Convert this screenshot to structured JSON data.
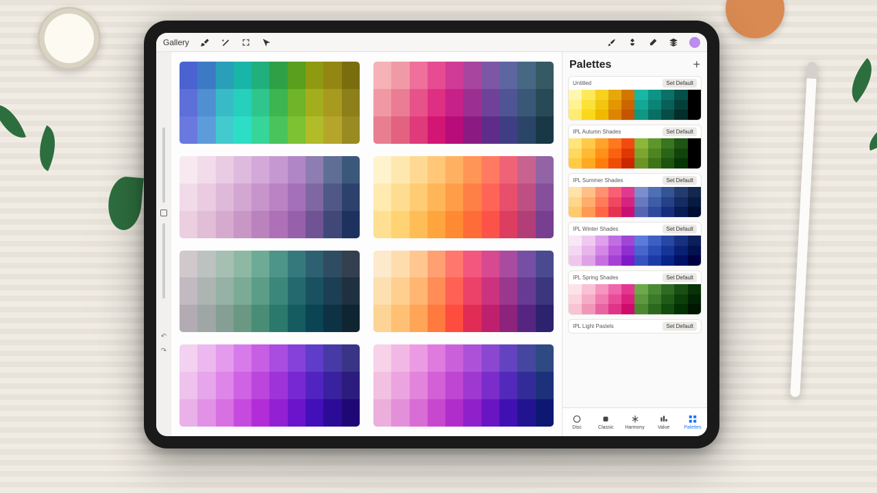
{
  "toolbar": {
    "gallery_label": "Gallery"
  },
  "panel": {
    "title": "Palettes",
    "set_default_label": "Set Default",
    "palettes": [
      {
        "name": "Untitled"
      },
      {
        "name": "IPL Autumn Shades"
      },
      {
        "name": "IPL Summer Shades"
      },
      {
        "name": "IPL Winter Shades"
      },
      {
        "name": "IPL Spring Shades"
      },
      {
        "name": "IPL Light Pastels"
      }
    ],
    "tabs": [
      {
        "label": "Disc"
      },
      {
        "label": "Classic"
      },
      {
        "label": "Harmony"
      },
      {
        "label": "Value"
      },
      {
        "label": "Palettes"
      }
    ],
    "active_tab": "Palettes"
  },
  "canvas_blocks": [
    {
      "name": "block-1",
      "rows": [
        [
          "#4a63d0",
          "#3d7ac6",
          "#2a9fb9",
          "#18b6a8",
          "#1fb07d",
          "#2fa046",
          "#5a9f1d",
          "#8f9a10",
          "#938612",
          "#7a6d0e"
        ],
        [
          "#5d6fd8",
          "#5090d2",
          "#38bbc6",
          "#26d0bc",
          "#2fc68e",
          "#3db551",
          "#6fb429",
          "#a3ae1c",
          "#a8991f",
          "#8d7f19"
        ],
        [
          "#6a79df",
          "#5d9cdb",
          "#43cacf",
          "#2ddec7",
          "#37d598",
          "#49c45c",
          "#7cc233",
          "#b1bc28",
          "#b5a62b",
          "#998a22"
        ]
      ]
    },
    {
      "name": "block-2",
      "rows": [
        [
          "#f6b2b7",
          "#f19aa7",
          "#ef709a",
          "#e74c93",
          "#d03b97",
          "#a8469f",
          "#7e56a6",
          "#5d66a1",
          "#476884",
          "#365a63"
        ],
        [
          "#f099a4",
          "#ea7d93",
          "#e8528a",
          "#de2f83",
          "#c52189",
          "#9b3092",
          "#704199",
          "#4f5494",
          "#395777",
          "#284956"
        ],
        [
          "#e97e91",
          "#e2627f",
          "#df3b7a",
          "#d31573",
          "#b70c7a",
          "#8b1b82",
          "#602c89",
          "#3f3e85",
          "#2a4568",
          "#193847"
        ]
      ]
    },
    {
      "name": "block-3",
      "rows": [
        [
          "#f8e9f1",
          "#f2dbea",
          "#e9cbe3",
          "#debade",
          "#d2a9d8",
          "#c698d2",
          "#b186c7",
          "#8d7db0",
          "#5f6e94",
          "#3b587a"
        ],
        [
          "#f2dbe8",
          "#eacbe0",
          "#dfb9d9",
          "#d3a7d2",
          "#c794cb",
          "#bb82c4",
          "#a470b9",
          "#7e67a2",
          "#4f5886",
          "#2c426c"
        ],
        [
          "#ebcee0",
          "#e1bdd6",
          "#d5aace",
          "#c897c6",
          "#bb83be",
          "#ae70b6",
          "#9760ab",
          "#705394",
          "#404878",
          "#1d325e"
        ]
      ]
    },
    {
      "name": "block-4",
      "rows": [
        [
          "#fff3cd",
          "#ffe8b0",
          "#ffd993",
          "#ffc777",
          "#ffb161",
          "#ff9556",
          "#ff7a60",
          "#f06377",
          "#c8628e",
          "#9263a5"
        ],
        [
          "#ffeab0",
          "#ffdd90",
          "#ffcb73",
          "#ffb658",
          "#ff9d48",
          "#ff8047",
          "#ff6556",
          "#e84f6c",
          "#be4f83",
          "#864f9b"
        ],
        [
          "#ffe092",
          "#ffd273",
          "#ffbd57",
          "#ffa53e",
          "#ff8a33",
          "#fe6d37",
          "#fd5249",
          "#dd3d60",
          "#b13e77",
          "#783e8f"
        ]
      ]
    },
    {
      "name": "block-5",
      "rows": [
        [
          "#d0c8cb",
          "#bcc2c0",
          "#a6bfb3",
          "#8db9a4",
          "#6eab97",
          "#4d9489",
          "#36797d",
          "#2d6070",
          "#2f4d62",
          "#34404f"
        ],
        [
          "#c2bac0",
          "#adb5b3",
          "#96b1a5",
          "#7cab95",
          "#5c9d88",
          "#3b877b",
          "#24696e",
          "#1a5161",
          "#1c3f53",
          "#1f3140"
        ],
        [
          "#b3abb3",
          "#9ea7a5",
          "#859f95",
          "#6a9883",
          "#498d77",
          "#2b786c",
          "#145c60",
          "#0b4453",
          "#0d3244",
          "#102532"
        ]
      ]
    },
    {
      "name": "block-6",
      "rows": [
        [
          "#fdeacc",
          "#ffdcae",
          "#ffc690",
          "#ffa072",
          "#ff776d",
          "#f4577d",
          "#d74991",
          "#a94ca0",
          "#764fa5",
          "#4b4a91"
        ],
        [
          "#fde0b1",
          "#ffcf90",
          "#ffb672",
          "#ff8d57",
          "#ff6155",
          "#ec4169",
          "#cc337f",
          "#9c378e",
          "#673a93",
          "#3c367f"
        ],
        [
          "#fcd496",
          "#ffc074",
          "#ffa557",
          "#ff7a3f",
          "#fe4d3f",
          "#e12d55",
          "#bf206d",
          "#8d237c",
          "#562581",
          "#2c226d"
        ]
      ]
    },
    {
      "name": "block-7",
      "rows": [
        [
          "#f2d2f0",
          "#ecb8ef",
          "#e49bee",
          "#d87bea",
          "#c65fe4",
          "#a94de0",
          "#8541da",
          "#5f3cc9",
          "#4739a6",
          "#3a3486"
        ],
        [
          "#eec2ec",
          "#e7a5eb",
          "#de85e9",
          "#d062e4",
          "#bc45de",
          "#9f33da",
          "#7828d3",
          "#5124c1",
          "#39219f",
          "#2c1c7e"
        ],
        [
          "#e9b1e8",
          "#e192e6",
          "#d770e3",
          "#c74adf",
          "#b22cd8",
          "#9320d3",
          "#6b14cc",
          "#430fb9",
          "#2c0c97",
          "#1f0876"
        ]
      ]
    },
    {
      "name": "block-8",
      "rows": [
        [
          "#f7d2e8",
          "#f2b8e5",
          "#eb9be3",
          "#df7ade",
          "#cb61da",
          "#ad52d8",
          "#8b47d2",
          "#6443c1",
          "#45469f",
          "#2f4a82"
        ],
        [
          "#f2c1e2",
          "#eba4df",
          "#e284dc",
          "#d460d7",
          "#bf46d3",
          "#9f38d1",
          "#7b2dcb",
          "#5229ba",
          "#332c98",
          "#1d307a"
        ],
        [
          "#ecaedc",
          "#e38fd9",
          "#d86dd5",
          "#c847cf",
          "#b12dcb",
          "#9020c9",
          "#6915c3",
          "#4011b2",
          "#221490",
          "#0c1872"
        ]
      ]
    }
  ],
  "mini_palettes": [
    {
      "rows": [
        [
          "#fff7b0",
          "#fdea5a",
          "#f6d21e",
          "#e7a80c",
          "#d27600",
          "#17b8a6",
          "#0f9387",
          "#0b7168",
          "#06504a",
          "#000000"
        ],
        [
          "#fff290",
          "#fce13a",
          "#f3c50e",
          "#e39600",
          "#cc6500",
          "#13a895",
          "#0c8377",
          "#086058",
          "#04403a",
          "#000000"
        ],
        [
          "#ffec70",
          "#fad81c",
          "#efb900",
          "#de8400",
          "#c55400",
          "#0f9784",
          "#096f64",
          "#054d46",
          "#022f2a",
          "#000000"
        ]
      ]
    },
    {
      "rows": [
        [
          "#ffe57a",
          "#ffc94a",
          "#ffa32a",
          "#ff7820",
          "#f34a10",
          "#8db63a",
          "#5e962c",
          "#3a7520",
          "#1f5414",
          "#000000"
        ],
        [
          "#ffd85e",
          "#ffb934",
          "#ff9018",
          "#fa620f",
          "#e13705",
          "#7da52f",
          "#4e8521",
          "#2a6416",
          "#11440c",
          "#000000"
        ],
        [
          "#ffcb44",
          "#ffa920",
          "#ff7e0b",
          "#f04c05",
          "#cd2500",
          "#6c9424",
          "#3e7417",
          "#1c530d",
          "#073404",
          "#000000"
        ]
      ]
    },
    {
      "rows": [
        [
          "#ffe3a8",
          "#ffc087",
          "#ff9070",
          "#f85f74",
          "#e23990",
          "#7a8dcc",
          "#4f6fb5",
          "#355496",
          "#233c70",
          "#14284d"
        ],
        [
          "#ffd68a",
          "#ffad6d",
          "#ff7b5a",
          "#f04862",
          "#d62381",
          "#6879c0",
          "#3e5ca8",
          "#254189",
          "#142b63",
          "#071a40"
        ],
        [
          "#ffc96d",
          "#ff9a54",
          "#fe6646",
          "#e63251",
          "#c91072",
          "#5565b3",
          "#2d4a9b",
          "#162f7c",
          "#081c56",
          "#000d33"
        ]
      ]
    },
    {
      "rows": [
        [
          "#f9e7f6",
          "#f0c9f1",
          "#de9fec",
          "#c26ee3",
          "#9f46d7",
          "#5a7bd9",
          "#3b5fc2",
          "#2647a3",
          "#173180",
          "#0b1f5c"
        ],
        [
          "#f4d8f1",
          "#e8b5ec",
          "#d387e6",
          "#b556dc",
          "#902fd0",
          "#4866cd",
          "#2a4cb5",
          "#163596",
          "#0a2073",
          "#02114f"
        ],
        [
          "#eec8ec",
          "#dfa2e6",
          "#c66fdf",
          "#a540d5",
          "#8019c8",
          "#3752c0",
          "#1b3aa8",
          "#092489",
          "#001166",
          "#000042"
        ]
      ]
    },
    {
      "rows": [
        [
          "#fde3e8",
          "#f9c1d4",
          "#f596c0",
          "#ef66aa",
          "#e43690",
          "#6fa84a",
          "#4a8a34",
          "#2f6c22",
          "#1a4e13",
          "#083208"
        ],
        [
          "#fbd4de",
          "#f6acc6",
          "#f07cb1",
          "#e84c99",
          "#db207f",
          "#5e983e",
          "#3a7a29",
          "#205c18",
          "#0d3f0b",
          "#002404"
        ],
        [
          "#f8c4d4",
          "#f296b8",
          "#ea63a1",
          "#df3487",
          "#cf0c6e",
          "#4e8732",
          "#2b6a1e",
          "#124c0e",
          "#033005",
          "#001600"
        ]
      ]
    }
  ]
}
